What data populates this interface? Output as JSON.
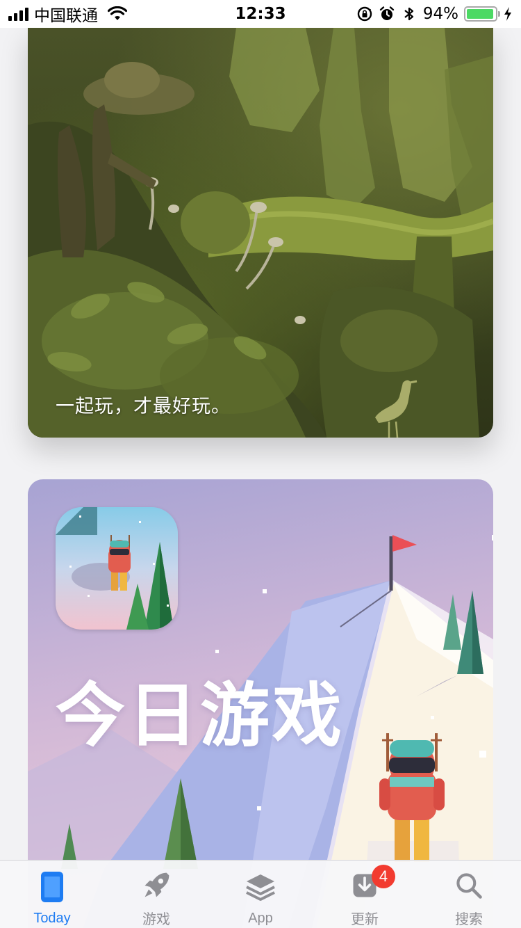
{
  "status_bar": {
    "carrier": "中国联通",
    "time": "12:33",
    "battery_percent": "94%",
    "battery_level": 0.94,
    "icons": [
      "signal-icon",
      "wifi-icon",
      "rotation-lock-icon",
      "alarm-icon",
      "bluetooth-icon",
      "battery-icon",
      "charging-icon"
    ]
  },
  "cards": [
    {
      "caption": "一起玩，才最好玩。",
      "image": "forest-fantasy-illustration"
    },
    {
      "title": "今日游戏",
      "image": "snowy-mountain-illustration",
      "app_icon": "game-app-icon"
    }
  ],
  "tab_bar": {
    "tabs": [
      {
        "label": "Today",
        "icon": "today-icon",
        "active": true
      },
      {
        "label": "游戏",
        "icon": "rocket-icon"
      },
      {
        "label": "App",
        "icon": "app-stack-icon"
      },
      {
        "label": "更新",
        "icon": "download-icon",
        "badge": "4"
      },
      {
        "label": "搜索",
        "icon": "search-icon"
      }
    ]
  },
  "colors": {
    "accent": "#1e7cf2",
    "inactive": "#8e8e93",
    "badge": "#f23b30",
    "battery": "#4cd964"
  }
}
